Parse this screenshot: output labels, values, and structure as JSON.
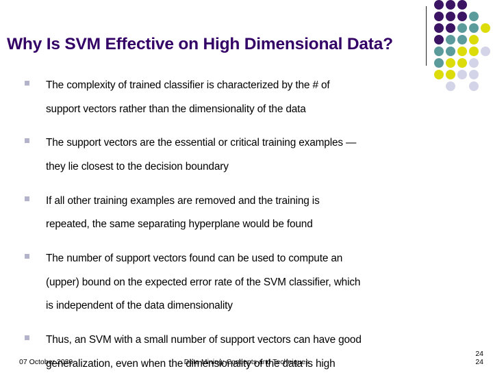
{
  "slide": {
    "title": "Why Is SVM Effective on High Dimensional Data?",
    "bullet_marker": "square-bullet-icon",
    "bullets": [
      {
        "lines": [
          "The complexity of trained classifier is characterized by the # of",
          "support vectors rather than the dimensionality of the data"
        ]
      },
      {
        "lines": [
          "The support vectors are the essential or critical training examples —",
          "they lie closest to the decision boundary"
        ]
      },
      {
        "lines": [
          "If all other training examples are removed and the training is",
          "repeated, the same separating hyperplane would be found"
        ]
      },
      {
        "lines": [
          "The number of support vectors found can be used to compute an",
          "(upper) bound on the expected error rate of the SVM classifier, which",
          "is independent of the data dimensionality"
        ]
      },
      {
        "lines": [
          "Thus, an SVM with a small number of support vectors can have good",
          "generalization, even when the dimensionality of the data is high"
        ]
      }
    ]
  },
  "footer": {
    "date": "07 October 2020",
    "center": "Data Mining: Concepts and Techniques",
    "page_number_top": "24",
    "page_number_bottom": "24"
  },
  "colors": {
    "title": "#330066",
    "dark_purple": "#3B1464",
    "teal": "#5C9B9B",
    "yellow": "#DCDC0A",
    "lavender": "#D4D4E8",
    "bullet": "#B3B3CC",
    "rule": "#231F20",
    "text": "#000000",
    "background": "#FFFFFF"
  },
  "decoration": {
    "name": "dot-grid",
    "cell": 17,
    "dots": [
      {
        "col": 0,
        "row": 0,
        "color": "#3B1464"
      },
      {
        "col": 1,
        "row": 0,
        "color": "#3B1464"
      },
      {
        "col": 2,
        "row": 0,
        "color": "#3B1464"
      },
      {
        "col": 0,
        "row": 1,
        "color": "#3B1464"
      },
      {
        "col": 1,
        "row": 1,
        "color": "#3B1464"
      },
      {
        "col": 2,
        "row": 1,
        "color": "#3B1464"
      },
      {
        "col": 3,
        "row": 1,
        "color": "#5C9B9B"
      },
      {
        "col": 0,
        "row": 2,
        "color": "#3B1464"
      },
      {
        "col": 1,
        "row": 2,
        "color": "#3B1464"
      },
      {
        "col": 2,
        "row": 2,
        "color": "#5C9B9B"
      },
      {
        "col": 3,
        "row": 2,
        "color": "#5C9B9B"
      },
      {
        "col": 4,
        "row": 2,
        "color": "#DCDC0A"
      },
      {
        "col": 0,
        "row": 3,
        "color": "#3B1464"
      },
      {
        "col": 1,
        "row": 3,
        "color": "#5C9B9B"
      },
      {
        "col": 2,
        "row": 3,
        "color": "#5C9B9B"
      },
      {
        "col": 3,
        "row": 3,
        "color": "#DCDC0A"
      },
      {
        "col": 0,
        "row": 4,
        "color": "#5C9B9B"
      },
      {
        "col": 1,
        "row": 4,
        "color": "#5C9B9B"
      },
      {
        "col": 2,
        "row": 4,
        "color": "#DCDC0A"
      },
      {
        "col": 3,
        "row": 4,
        "color": "#DCDC0A"
      },
      {
        "col": 4,
        "row": 4,
        "color": "#D4D4E8"
      },
      {
        "col": 0,
        "row": 5,
        "color": "#5C9B9B"
      },
      {
        "col": 1,
        "row": 5,
        "color": "#DCDC0A"
      },
      {
        "col": 2,
        "row": 5,
        "color": "#DCDC0A"
      },
      {
        "col": 3,
        "row": 5,
        "color": "#D4D4E8"
      },
      {
        "col": 0,
        "row": 6,
        "color": "#DCDC0A"
      },
      {
        "col": 1,
        "row": 6,
        "color": "#DCDC0A"
      },
      {
        "col": 2,
        "row": 6,
        "color": "#D4D4E8"
      },
      {
        "col": 3,
        "row": 6,
        "color": "#D4D4E8"
      },
      {
        "col": 1,
        "row": 7,
        "color": "#D4D4E8"
      },
      {
        "col": 3,
        "row": 7,
        "color": "#D4D4E8"
      }
    ]
  }
}
